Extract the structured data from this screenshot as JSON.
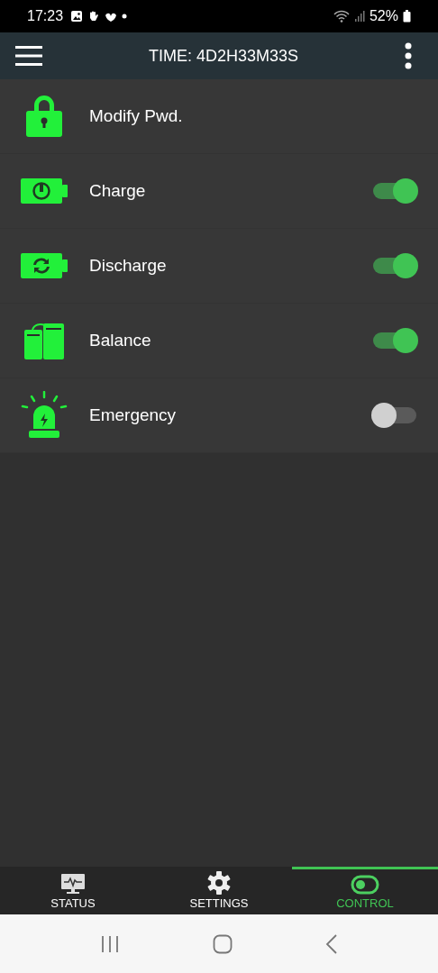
{
  "status_bar": {
    "time": "17:23",
    "battery": "52%"
  },
  "header": {
    "title": "TIME: 4D2H33M33S"
  },
  "rows": [
    {
      "label": "Modify Pwd.",
      "kind": "link"
    },
    {
      "label": "Charge",
      "kind": "toggle",
      "on": true
    },
    {
      "label": "Discharge",
      "kind": "toggle",
      "on": true
    },
    {
      "label": "Balance",
      "kind": "toggle",
      "on": true
    },
    {
      "label": "Emergency",
      "kind": "toggle",
      "on": false
    }
  ],
  "tabs": [
    {
      "label": "STATUS",
      "selected": false
    },
    {
      "label": "SETTINGS",
      "selected": false
    },
    {
      "label": "CONTROL",
      "selected": true
    }
  ]
}
